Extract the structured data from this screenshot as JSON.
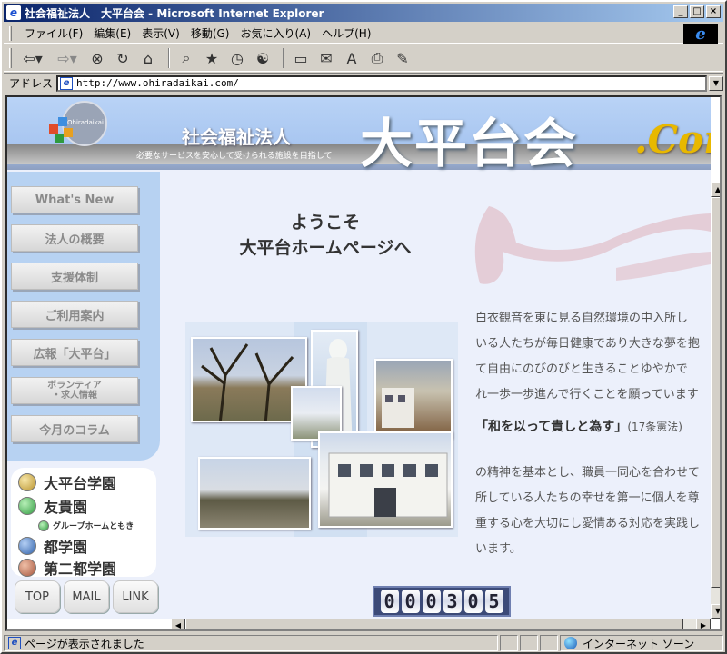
{
  "window": {
    "title": "社会福祉法人　大平台会 - Microsoft Internet Explorer",
    "ie_mini_glyph": "e",
    "controls": {
      "minimize": "_",
      "maximize": "□",
      "close": "×"
    }
  },
  "menu": {
    "items": [
      "ファイル(F)",
      "編集(E)",
      "表示(V)",
      "移動(G)",
      "お気に入り(A)",
      "ヘルプ(H)"
    ],
    "logo_glyph": "e"
  },
  "toolbar": {
    "icons": [
      "back-icon",
      "forward-icon",
      "stop-icon",
      "refresh-icon",
      "home-icon",
      "search-icon",
      "favorites-icon",
      "history-icon",
      "channels-icon",
      "fullscreen-icon",
      "mail-icon",
      "font-size-icon",
      "print-icon",
      "edit-icon"
    ],
    "glyphs": {
      "back": "⇦▾",
      "forward": "⇨▾",
      "stop": "⊗",
      "refresh": "↻",
      "home": "⌂",
      "search": "⌕",
      "favorites": "★",
      "history": "◷",
      "channels": "☯",
      "fullscreen": "▭",
      "mail": "✉",
      "font": "A",
      "print": "⎙",
      "edit": "✎"
    }
  },
  "address": {
    "label": "アドレス",
    "url": "http://www.ohiradaikai.com/",
    "page_glyph": "e",
    "dropdown_glyph": "▼"
  },
  "banner": {
    "org_type": "社会福祉法人",
    "slogan": "必要なサービスを安心して受けられる施設を目指して",
    "site_name": "大平台会",
    "site_suffix": ".Com",
    "logo_text": "Ohiradaikai"
  },
  "sidenav": {
    "items": [
      "What's New",
      "法人の概要",
      "支援体制",
      "ご利用案内",
      "広報「大平台」",
      "ボランティア",
      "・求人情報",
      "今月のコラム"
    ]
  },
  "facilities": {
    "items": [
      {
        "label": "大平台学園",
        "color": "#b8922c"
      },
      {
        "label": "友貴園",
        "color": "#2f9a3f"
      },
      {
        "label": "グループホームともき",
        "color": "#2f9a3f"
      },
      {
        "label": "都学園",
        "color": "#2d5fa8"
      },
      {
        "label": "第二都学園",
        "color": "#a4543c"
      }
    ]
  },
  "buttons": {
    "top": "TOP",
    "mail": "MAIL",
    "link": "LINK"
  },
  "welcome": {
    "line1": "ようこそ",
    "line2": "大平台ホームページへ"
  },
  "intro": {
    "lines": [
      "白衣観音を東に見る自然環境の中入所し",
      "いる人たちが毎日健康であり大きな夢を抱",
      "て自由にのびのびと生きることゆやかで",
      "れ一歩一歩進んで行くことを願っています"
    ]
  },
  "motto": {
    "text": "「和を以って貴しと為す」",
    "note": "(17条憲法)"
  },
  "body": {
    "lines": [
      "の精神を基本とし、職員一同心を合わせて",
      "所している人たちの幸せを第一に個人を尊",
      "重する心を大切にし愛情ある対応を実践し",
      "います。"
    ]
  },
  "counter": {
    "digits": [
      "0",
      "0",
      "0",
      "3",
      "0",
      "5"
    ]
  },
  "scroll": {
    "up": "▲",
    "down": "▼",
    "left": "◀",
    "right": "▶"
  },
  "status": {
    "text": "ページが表示されました",
    "zone": "インターネット ゾーン",
    "page_glyph": "e"
  }
}
